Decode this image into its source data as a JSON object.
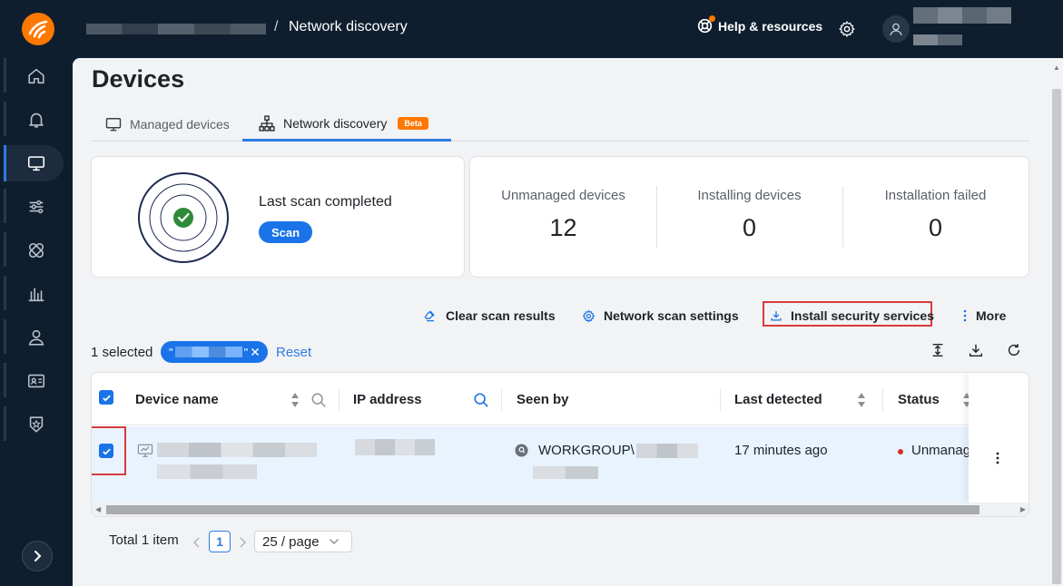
{
  "header": {
    "breadcrumb_current": "Network discovery",
    "breadcrumb_separator": "/",
    "help_label": "Help & resources"
  },
  "sidebar": {
    "items": [
      {
        "icon": "home-icon"
      },
      {
        "icon": "bell-icon"
      },
      {
        "icon": "monitor-icon",
        "active": true
      },
      {
        "icon": "sliders-icon"
      },
      {
        "icon": "bandage-icon"
      },
      {
        "icon": "bar-chart-icon"
      },
      {
        "icon": "user-icon"
      },
      {
        "icon": "id-card-icon"
      },
      {
        "icon": "badge-star-icon"
      }
    ]
  },
  "page": {
    "title": "Devices",
    "tabs": [
      {
        "label": "Managed devices",
        "active": false
      },
      {
        "label": "Network discovery",
        "active": true,
        "badge": "Beta"
      }
    ]
  },
  "scan": {
    "status": "Last scan completed",
    "button": "Scan"
  },
  "stats": [
    {
      "label": "Unmanaged devices",
      "value": "12"
    },
    {
      "label": "Installing devices",
      "value": "0"
    },
    {
      "label": "Installation failed",
      "value": "0"
    }
  ],
  "toolbar": {
    "clear": "Clear scan results",
    "settings": "Network scan settings",
    "install": "Install security services",
    "more": "More"
  },
  "selection": {
    "count_label": "1 selected",
    "chip_quote_open": "\"",
    "chip_quote_close": "\"",
    "reset": "Reset"
  },
  "table": {
    "columns": [
      "Device name",
      "IP address",
      "Seen by",
      "Last detected",
      "Status"
    ],
    "rows": [
      {
        "seen_by": "WORKGROUP\\",
        "last_detected": "17 minutes ago",
        "status": "Unmanag",
        "selected": true
      }
    ]
  },
  "pagination": {
    "total": "Total 1 item",
    "current_page": "1",
    "page_size": "25 / page"
  },
  "colors": {
    "accent": "#1a73e8",
    "brand": "#ff7800",
    "highlight_border": "#d93a3a",
    "success": "#2e8b3a",
    "status_dot": "#d93025"
  }
}
